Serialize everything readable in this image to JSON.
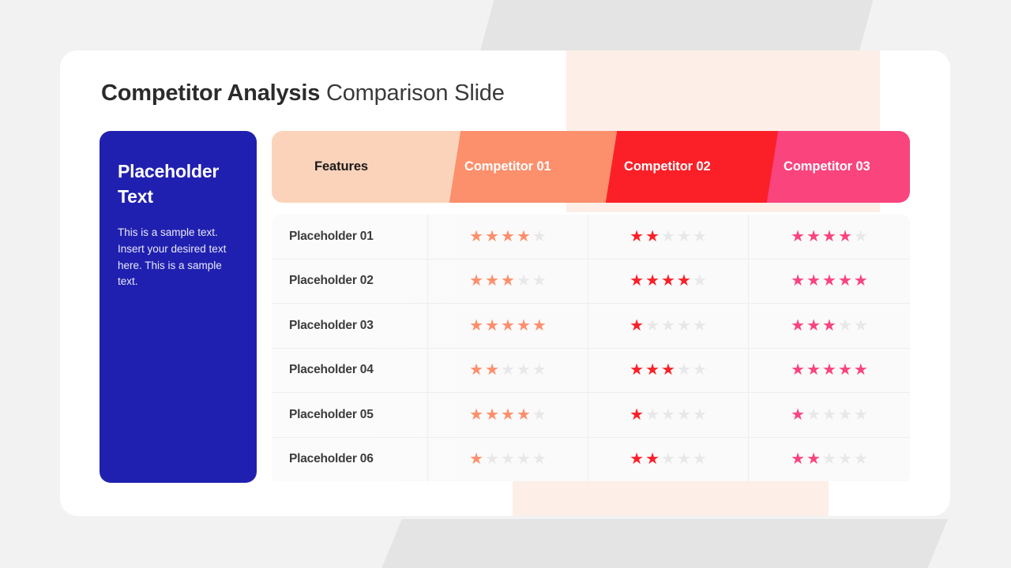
{
  "title": {
    "bold": "Competitor Analysis",
    "light": " Comparison Slide"
  },
  "side_panel": {
    "heading": "Placeholder Text",
    "body": "This is a sample text. Insert your desired text here. This is a sample text."
  },
  "colors": {
    "panel_blue": "#2020b0",
    "features_header": "#fbd3bb",
    "competitor_01": "#fc8f6c",
    "competitor_02": "#fb2028",
    "competitor_03": "#f9447e",
    "empty_star": "#e8e8e8",
    "card_accent_peach": "#fdeee8",
    "page_background": "#f2f2f2"
  },
  "table": {
    "headers": [
      "Features",
      "Competitor 01",
      "Competitor 02",
      "Competitor 03"
    ],
    "max_rating": 5,
    "rows": [
      {
        "label": "Placeholder 01",
        "ratings": [
          4,
          2,
          4
        ]
      },
      {
        "label": "Placeholder 02",
        "ratings": [
          3,
          4,
          5
        ]
      },
      {
        "label": "Placeholder 03",
        "ratings": [
          5,
          1,
          3
        ]
      },
      {
        "label": "Placeholder 04",
        "ratings": [
          2,
          3,
          5
        ]
      },
      {
        "label": "Placeholder 05",
        "ratings": [
          4,
          1,
          1
        ]
      },
      {
        "label": "Placeholder 06",
        "ratings": [
          1,
          2,
          2
        ]
      }
    ],
    "star_glyph": "★",
    "star_icon_name": "star-icon"
  }
}
